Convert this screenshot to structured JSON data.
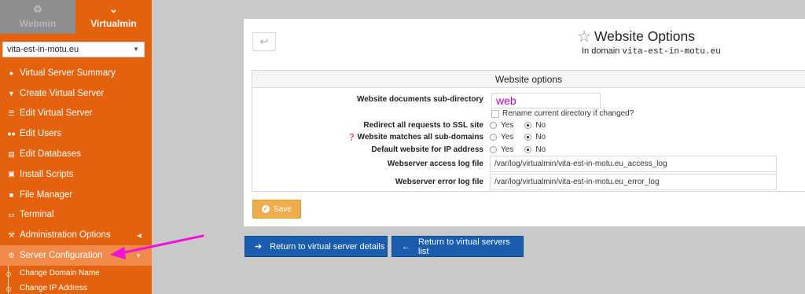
{
  "sidebar": {
    "tabs": [
      {
        "label": "Webmin",
        "icon": "webmin-logo-icon"
      },
      {
        "label": "Virtualmin",
        "icon": "chevron-down-icon"
      }
    ],
    "domain_select": {
      "value": "vita-est-in-motu.eu"
    },
    "items": [
      {
        "label": "Virtual Server Summary",
        "icon": "info-icon"
      },
      {
        "label": "Create Virtual Server",
        "icon": "create-icon"
      },
      {
        "label": "Edit Virtual Server",
        "icon": "sliders-icon"
      },
      {
        "label": "Edit Users",
        "icon": "users-icon"
      },
      {
        "label": "Edit Databases",
        "icon": "database-icon"
      },
      {
        "label": "Install Scripts",
        "icon": "scripts-icon"
      },
      {
        "label": "File Manager",
        "icon": "folder-icon"
      },
      {
        "label": "Terminal",
        "icon": "terminal-icon"
      },
      {
        "label": "Administration Options",
        "icon": "wrench-icon"
      },
      {
        "label": "Server Configuration",
        "icon": "gears-icon"
      }
    ],
    "subitems": [
      {
        "label": "Change Domain Name"
      },
      {
        "label": "Change IP Address"
      }
    ]
  },
  "header": {
    "title": "Website Options",
    "subtitle_prefix": "In domain",
    "subtitle_domain": "vita-est-in-motu.eu"
  },
  "options": {
    "section_title": "Website options",
    "doc_subdir": {
      "label": "Website documents sub-directory",
      "value": "web"
    },
    "rename_checkbox": {
      "label": "Rename current directory if changed?",
      "checked": false
    },
    "redirect_ssl": {
      "label": "Redirect all requests to SSL site",
      "yes": "Yes",
      "no": "No",
      "selected": "No"
    },
    "subdomains": {
      "label": "Website matches all sub-domains",
      "yes": "Yes",
      "no": "No",
      "selected": "No"
    },
    "default_site": {
      "label": "Default website for IP address",
      "yes": "Yes",
      "no": "No",
      "selected": "No"
    },
    "access_log": {
      "label": "Webserver access log file",
      "value": "/var/log/virtualmin/vita-est-in-motu.eu_access_log"
    },
    "error_log": {
      "label": "Webserver error log file",
      "value": "/var/log/virtualmin/vita-est-in-motu.eu_error_log"
    }
  },
  "buttons": {
    "save": "Save",
    "return_details": "Return to virtual server details",
    "return_list": "Return to virtual servers list"
  },
  "colors": {
    "sidebar": "#e4620d",
    "accent_button": "#f0ad4e",
    "primary_button": "#1a5cae",
    "annotation_arrow": "#ee11dd"
  }
}
